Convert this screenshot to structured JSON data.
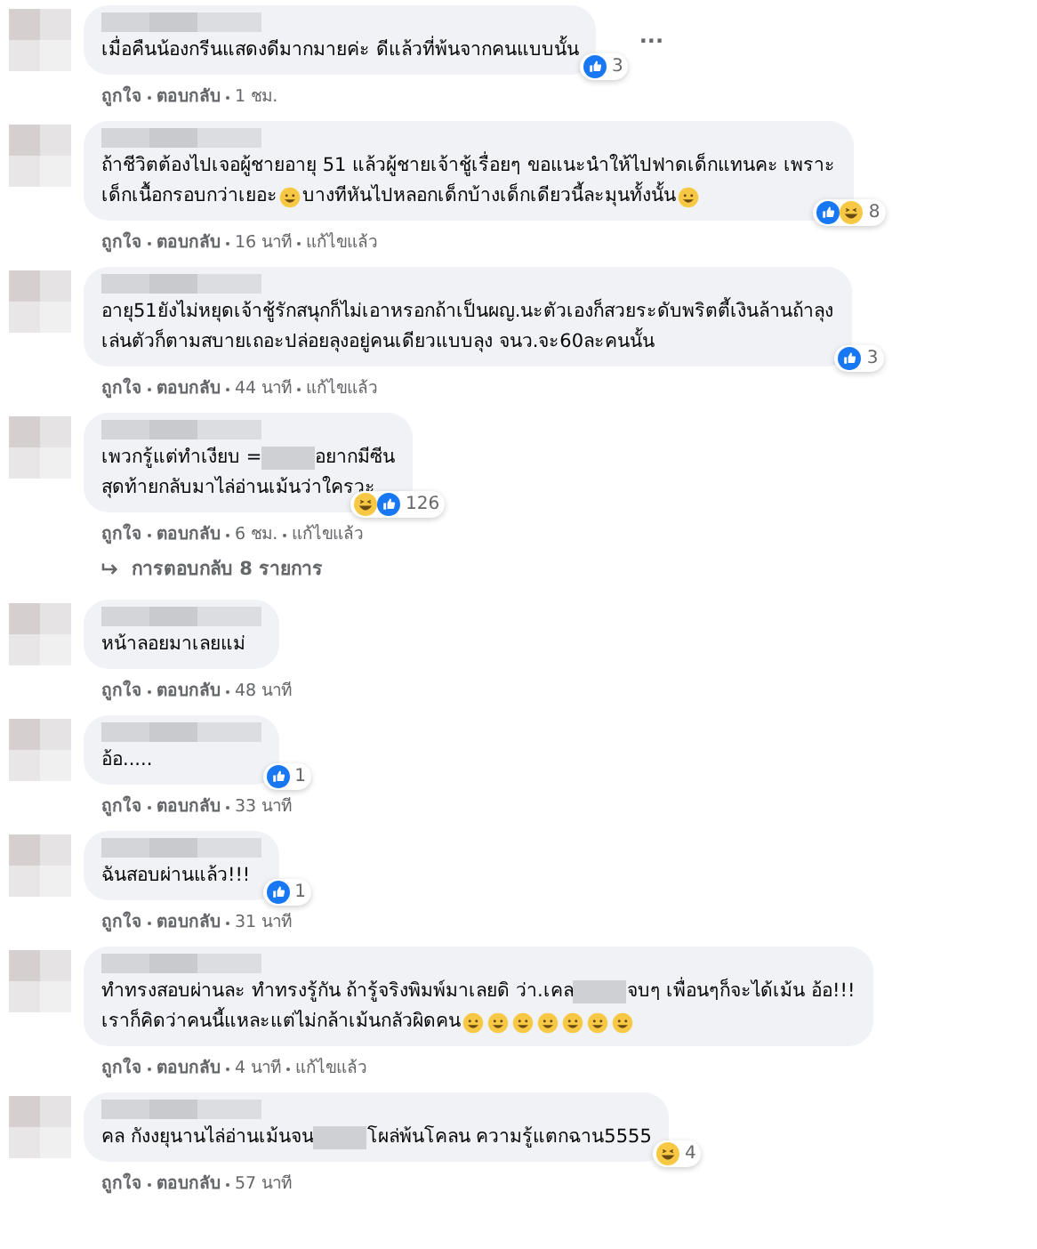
{
  "comments": [
    {
      "lines": [
        [
          {
            "kind": "text",
            "text": "เมื่อคืนน้องกรีนแสดงดีมากมายค่ะ ดีแล้วที่พ้นจากคนแบบนั้น"
          }
        ]
      ],
      "reactions": [
        {
          "kind": "like"
        }
      ],
      "count": "3",
      "more": "···",
      "actions": [
        "ถูกใจ",
        "ตอบกลับ"
      ],
      "time": "1 ชม."
    },
    {
      "lines": [
        [
          {
            "kind": "text",
            "text": "ถ้าชีวิตต้องไปเจอผู้ชายอายุ 51 แล้วผู้ชายเจ้าชู้เรื่อยๆ ขอแนะนำให้ไปฟาดเด็กแทนคะ เพราะ"
          }
        ],
        [
          {
            "kind": "text",
            "text": "เด็กเนื้อกรอบกว่าเยอะ"
          },
          {
            "kind": "emoji"
          },
          {
            "kind": "text",
            "text": "บางทีหันไปหลอกเด็กบ้างเด็กเดียวนี้ละมุนทั้งนั้น"
          },
          {
            "kind": "emoji"
          }
        ]
      ],
      "reactions": [
        {
          "kind": "like"
        },
        {
          "kind": "haha"
        }
      ],
      "count": "8",
      "actions": [
        "ถูกใจ",
        "ตอบกลับ"
      ],
      "time": "16 นาที",
      "edited": "แก้ไขแล้ว"
    },
    {
      "lines": [
        [
          {
            "kind": "text",
            "text": "อายุ51ยังไม่หยุดเจ้าชู้รักสนุกก็ไม่เอาหรอกถ้าเป็นผญ.นะตัวเองก็สวยระดับพริตตี้เงินล้านถ้าลุง"
          }
        ],
        [
          {
            "kind": "text",
            "text": "เล่นตัวก็ตามสบายเถอะปล่อยลุงอยู่คนเดียวแบบลุง จนว.จะ60ละคนนั้น"
          }
        ]
      ],
      "reactions": [
        {
          "kind": "like"
        }
      ],
      "count": "3",
      "actions": [
        "ถูกใจ",
        "ตอบกลับ"
      ],
      "time": "44 นาที",
      "edited": "แก้ไขแล้ว"
    },
    {
      "lines": [
        [
          {
            "kind": "text",
            "text": "เพวกรู้แต่ทำเงียบ = "
          },
          {
            "kind": "redacted"
          },
          {
            "kind": "text",
            "text": "อยากมีซีน"
          }
        ],
        [
          {
            "kind": "text",
            "text": "สุดท้ายกลับมาไล่อ่านเม้นว่าใครวะ"
          }
        ]
      ],
      "reactions": [
        {
          "kind": "haha"
        },
        {
          "kind": "like"
        }
      ],
      "count": "126",
      "actions": [
        "ถูกใจ",
        "ตอบกลับ"
      ],
      "time": "6 ชม.",
      "edited": "แก้ไขแล้ว",
      "replies": "การตอบกลับ 8 รายการ"
    },
    {
      "lines": [
        [
          {
            "kind": "text",
            "text": "หน้าลอยมาเลยแม่"
          }
        ]
      ],
      "actions": [
        "ถูกใจ",
        "ตอบกลับ"
      ],
      "time": "48 นาที"
    },
    {
      "lines": [
        [
          {
            "kind": "text",
            "text": "อ้อ....."
          }
        ]
      ],
      "reactions": [
        {
          "kind": "like"
        }
      ],
      "count": "1",
      "actions": [
        "ถูกใจ",
        "ตอบกลับ"
      ],
      "time": "33 นาที"
    },
    {
      "lines": [
        [
          {
            "kind": "text",
            "text": "ฉันสอบผ่านแล้ว!!!"
          }
        ]
      ],
      "reactions": [
        {
          "kind": "like"
        }
      ],
      "count": "1",
      "actions": [
        "ถูกใจ",
        "ตอบกลับ"
      ],
      "time": "31 นาที"
    },
    {
      "lines": [
        [
          {
            "kind": "text",
            "text": "ทำทรงสอบผ่านละ ทำทรงรู้กัน ถ้ารู้จริงพิมพ์มาเลยดิ ว่า.เคล"
          },
          {
            "kind": "redacted"
          },
          {
            "kind": "text",
            "text": "จบๆ เพื่อนๆก็จะได้เม้น อ้อ!!!"
          }
        ],
        [
          {
            "kind": "text",
            "text": "เราก็คิดว่าคนนี้แหละแต่ไม่กล้าเม้นกลัวผิดคน"
          },
          {
            "kind": "emoji"
          },
          {
            "kind": "emoji"
          },
          {
            "kind": "emoji"
          },
          {
            "kind": "emoji"
          },
          {
            "kind": "emoji"
          },
          {
            "kind": "emoji"
          },
          {
            "kind": "emoji"
          }
        ]
      ],
      "actions": [
        "ถูกใจ",
        "ตอบกลับ"
      ],
      "time": "4 นาที",
      "edited": "แก้ไขแล้ว"
    },
    {
      "lines": [
        [
          {
            "kind": "text",
            "text": "คล กังงยุนานไล่อ่านเม้นจน"
          },
          {
            "kind": "redacted"
          },
          {
            "kind": "text",
            "text": "โผล่พ้นโคลน ความรู้แตกฉาน5555"
          }
        ]
      ],
      "reactions": [
        {
          "kind": "haha"
        }
      ],
      "count": "4",
      "actions": [
        "ถูกใจ",
        "ตอบกลับ"
      ],
      "time": "57 นาที"
    }
  ]
}
